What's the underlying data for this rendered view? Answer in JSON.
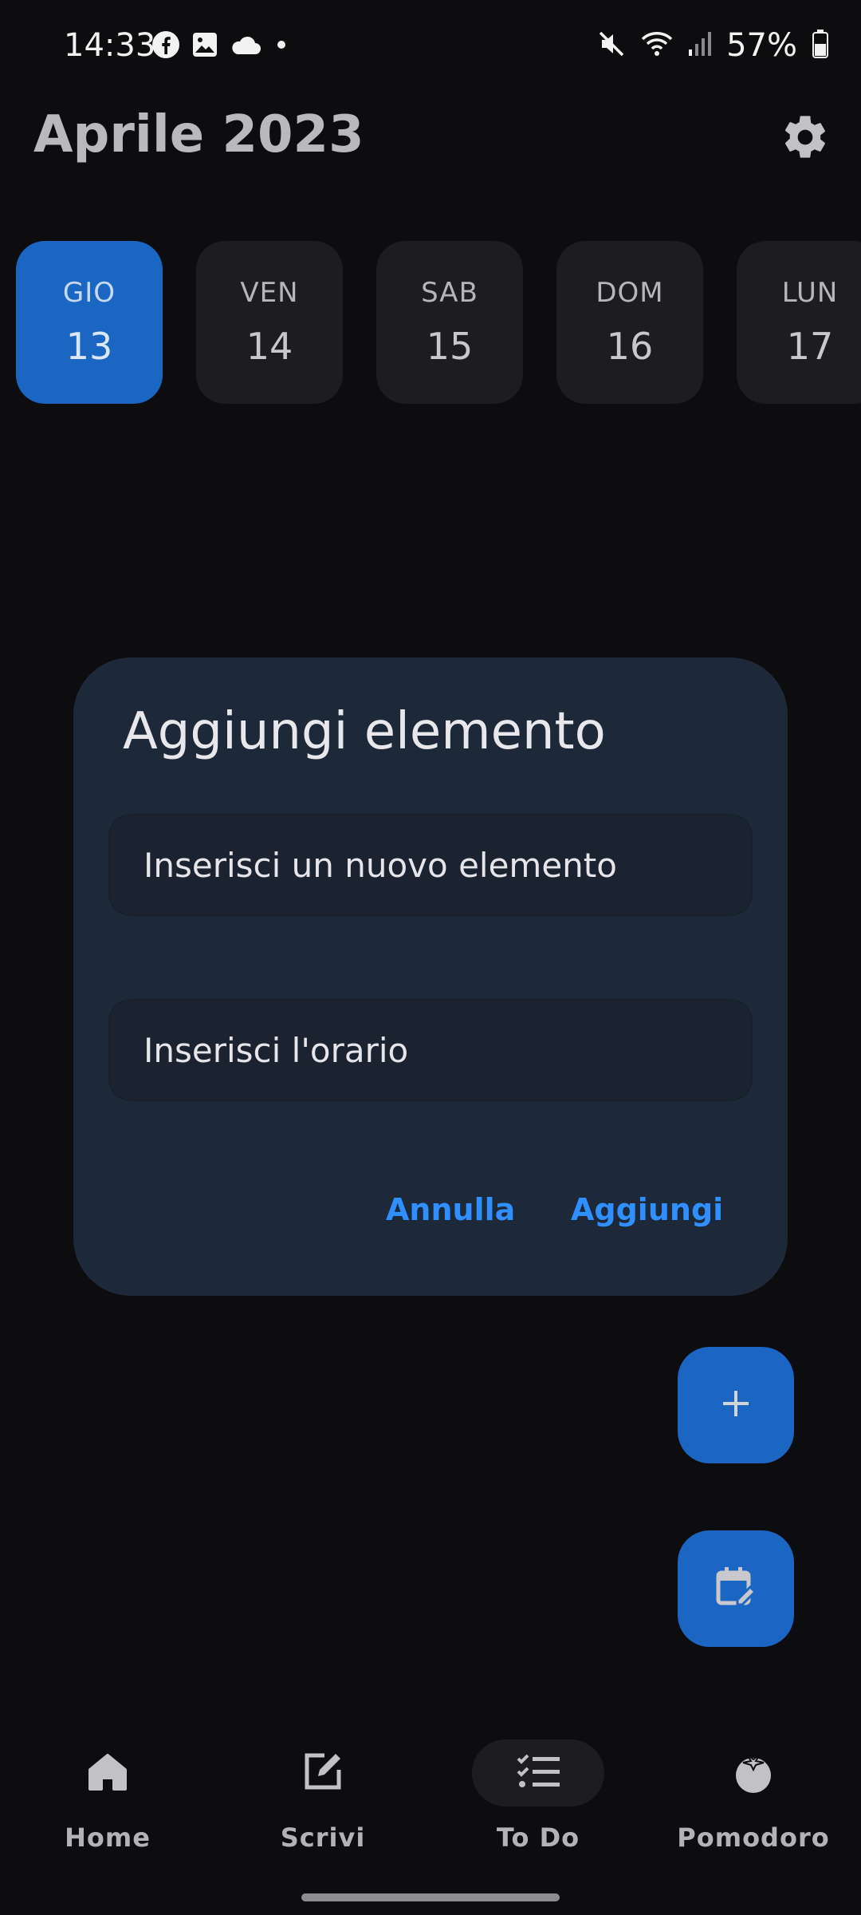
{
  "status_bar": {
    "time": "14:33",
    "battery": "57%",
    "icons_left": [
      "facebook-icon",
      "gallery-icon",
      "cloud-icon",
      "dot-icon"
    ],
    "icons_right": [
      "mute-icon",
      "wifi-icon",
      "signal-icon",
      "battery-icon"
    ]
  },
  "header": {
    "title": "Aprile 2023"
  },
  "days": [
    {
      "name": "GIO",
      "num": "13",
      "active": true
    },
    {
      "name": "VEN",
      "num": "14",
      "active": false
    },
    {
      "name": "SAB",
      "num": "15",
      "active": false
    },
    {
      "name": "DOM",
      "num": "16",
      "active": false
    },
    {
      "name": "LUN",
      "num": "17",
      "active": false
    }
  ],
  "dialog": {
    "title": "Aggiungi elemento",
    "item_placeholder": "Inserisci un nuovo elemento",
    "time_placeholder": "Inserisci l'orario",
    "cancel_label": "Annulla",
    "add_label": "Aggiungi"
  },
  "bottom_nav": {
    "items": [
      {
        "label": "Home",
        "icon": "home-icon",
        "selected": false
      },
      {
        "label": "Scrivi",
        "icon": "edit-icon",
        "selected": false
      },
      {
        "label": "To Do",
        "icon": "checklist-icon",
        "selected": true
      },
      {
        "label": "Pomodoro",
        "icon": "tomato-icon",
        "selected": false
      }
    ]
  },
  "colors": {
    "accent": "#1a66c2",
    "link": "#2f8fff",
    "background": "#0d0d10",
    "dialog": "#1d2838"
  }
}
